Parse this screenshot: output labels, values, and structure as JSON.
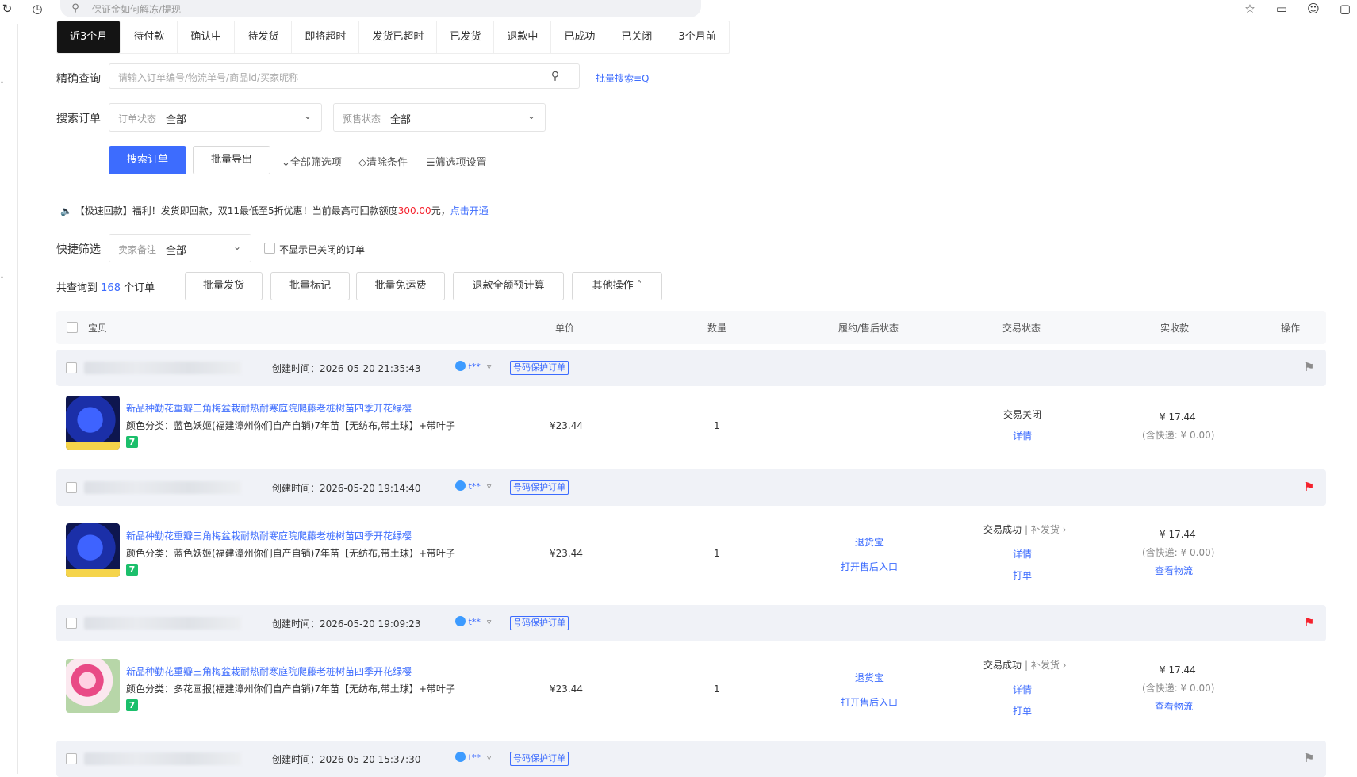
{
  "topbar": {
    "search_placeholder": "保证金如何解冻/提现",
    "icons": [
      "refresh-icon",
      "history-icon",
      "search-icon",
      "star-icon",
      "bookmark-icon",
      "bot-icon",
      "chat-icon"
    ]
  },
  "tabs": [
    "近3个月",
    "待付款",
    "确认中",
    "待发货",
    "即将超时",
    "发货已超时",
    "已发货",
    "退款中",
    "已成功",
    "已关闭",
    "3个月前"
  ],
  "filters": {
    "precise_label": "精确查询",
    "precise_placeholder": "请输入订单编号/物流单号/商品id/买家昵称",
    "batch_search": "批量搜索≡Q",
    "search_order_label": "搜索订单",
    "order_status_label": "订单状态",
    "order_status_value": "全部",
    "presale_label": "预售状态",
    "presale_value": "全部",
    "search_btn": "搜索订单",
    "export_btn": "批量导出",
    "all_filters": "⌄全部筛选项",
    "clear": "◇清除条件",
    "filter_settings": "☰筛选项设置"
  },
  "notice": {
    "prefix": "【极速回款】福利！发货即回款，双11最低至5折优惠！当前最高可回款额度",
    "amount": "300.00",
    "suffix": "元，",
    "link": "点击开通"
  },
  "quick": {
    "label": "快捷筛选",
    "remark_label": "卖家备注",
    "remark_value": "全部",
    "hide_closed": "不显示已关闭的订单"
  },
  "summary": {
    "prefix": "共查询到",
    "count": "168",
    "suffix": "个订单",
    "buttons": [
      "批量发货",
      "批量标记",
      "批量免运费",
      "退款全额预计算",
      "其他操作 ˄"
    ]
  },
  "table_headers": [
    "宝贝",
    "单价",
    "数量",
    "履约/售后状态",
    "交易状态",
    "实收款",
    "操作"
  ],
  "orders": [
    {
      "created": "创建时间：2026-05-20 21:35:43",
      "buyer": "t**",
      "tag": "号码保护订单",
      "flag_color": "#8c8c8c",
      "title": "新品种勤花重瓣三角梅盆栽耐热耐寒庭院爬藤老桩树苗四季开花绿樱",
      "spec": "颜色分类：蓝色妖姬(福建漳州你们自产自销)7年苗【无纺布,带土球】+带叶子",
      "price": "¥23.44",
      "qty": "1",
      "after_sale": [],
      "trade_status": "交易关闭",
      "trade_extra": "",
      "trade_links": [
        "详情"
      ],
      "received": "¥ 17.44",
      "shipping": "(含快递: ¥ 0.00)",
      "logistics": ""
    },
    {
      "created": "创建时间：2026-05-20 19:14:40",
      "buyer": "t**",
      "tag": "号码保护订单",
      "flag_color": "#f5222d",
      "title": "新品种勤花重瓣三角梅盆栽耐热耐寒庭院爬藤老桩树苗四季开花绿樱",
      "spec": "颜色分类：蓝色妖姬(福建漳州你们自产自销)7年苗【无纺布,带土球】+带叶子",
      "price": "¥23.44",
      "qty": "1",
      "after_sale": [
        "退货宝",
        "打开售后入口"
      ],
      "trade_status": "交易成功",
      "trade_extra": "| 补发货 ›",
      "trade_links": [
        "详情",
        "打单"
      ],
      "received": "¥ 17.44",
      "shipping": "(含快递: ¥ 0.00)",
      "logistics": "查看物流"
    },
    {
      "created": "创建时间：2026-05-20 19:09:23",
      "buyer": "t**",
      "tag": "号码保护订单",
      "flag_color": "#f5222d",
      "title": "新品种勤花重瓣三角梅盆栽耐热耐寒庭院爬藤老桩树苗四季开花绿樱",
      "spec": "颜色分类：多花画报(福建漳州你们自产自销)7年苗【无纺布,带土球】+带叶子",
      "price": "¥23.44",
      "qty": "1",
      "after_sale": [
        "退货宝",
        "打开售后入口"
      ],
      "trade_status": "交易成功",
      "trade_extra": "| 补发货 ›",
      "trade_links": [
        "详情",
        "打单"
      ],
      "received": "¥ 17.44",
      "shipping": "(含快递: ¥ 0.00)",
      "logistics": "查看物流"
    },
    {
      "created": "创建时间：2026-05-20 15:37:30",
      "buyer": "t**",
      "tag": "号码保护订单",
      "flag_color": "#8c8c8c"
    }
  ],
  "colors": {
    "accent": "#3d6cfe",
    "tab_active": "#141414",
    "red": "#f5222d"
  }
}
